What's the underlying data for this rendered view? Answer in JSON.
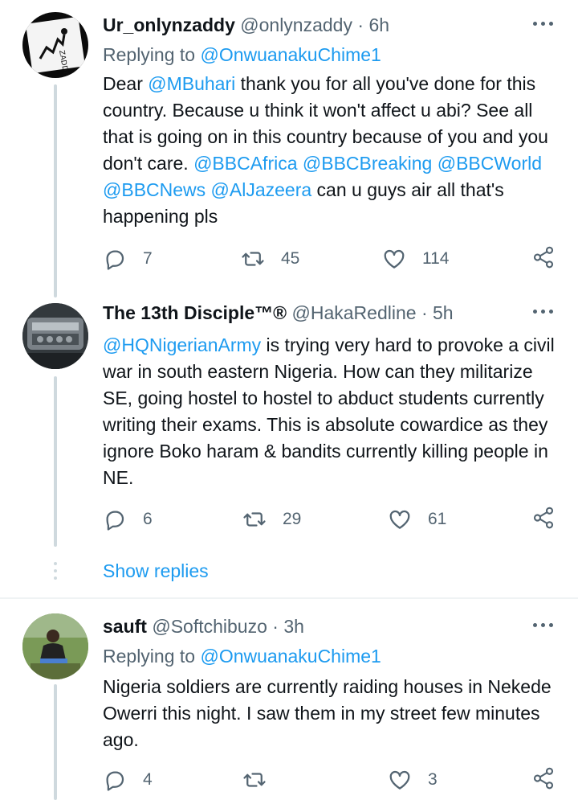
{
  "tweets": [
    {
      "name": "Ur_onlynzaddy",
      "handle": "@onlynzaddy",
      "time": "6h",
      "replying_label": "Replying to",
      "replying_to": "@OnwuanakuChime1",
      "body_parts": [
        {
          "t": "Dear ",
          "m": false
        },
        {
          "t": "@MBuhari",
          "m": true
        },
        {
          "t": "  thank you for all you've done for this country. Because u think it won't affect u abi? See all that is going on in this country because of you and you don't care. ",
          "m": false
        },
        {
          "t": "@BBCAfrica",
          "m": true
        },
        {
          "t": " ",
          "m": false
        },
        {
          "t": "@BBCBreaking",
          "m": true
        },
        {
          "t": " ",
          "m": false
        },
        {
          "t": "@BBCWorld",
          "m": true
        },
        {
          "t": "  ",
          "m": false
        },
        {
          "t": "@BBCNews",
          "m": true
        },
        {
          "t": "  ",
          "m": false
        },
        {
          "t": "@AlJazeera",
          "m": true
        },
        {
          "t": "  can u guys air all that's happening pls",
          "m": false
        }
      ],
      "replies": "7",
      "retweets": "45",
      "likes": "114"
    },
    {
      "name": "The 13th Disciple™®",
      "handle": "@HakaRedline",
      "time": "5h",
      "body_parts": [
        {
          "t": "@HQNigerianArmy",
          "m": true
        },
        {
          "t": " is trying very hard to provoke a civil war in south eastern Nigeria. How can they militarize SE, going hostel to hostel to abduct students currently writing their exams. This is absolute cowardice as they ignore Boko haram & bandits currently killing people in NE.",
          "m": false
        }
      ],
      "replies": "6",
      "retweets": "29",
      "likes": "61"
    },
    {
      "name": "sauft",
      "handle": "@Softchibuzo",
      "time": "3h",
      "replying_label": "Replying to",
      "replying_to": "@OnwuanakuChime1",
      "body_parts": [
        {
          "t": "Nigeria soldiers are currently raiding houses in Nekede Owerri this night. I saw them in my street few minutes ago.",
          "m": false
        }
      ],
      "replies": "4",
      "retweets": "",
      "likes": "3"
    }
  ],
  "show_replies": "Show replies",
  "separator": "·",
  "icons": [
    "reply-icon",
    "retweet-icon",
    "like-icon",
    "share-icon",
    "more-icon"
  ],
  "colors": {
    "accent": "#1d9bf0",
    "muted": "#536471",
    "text": "#0f1419",
    "thread": "#cfd9de"
  }
}
